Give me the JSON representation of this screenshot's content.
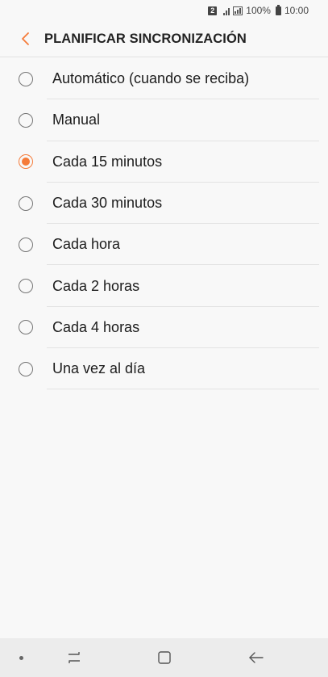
{
  "status_bar": {
    "sim_label": "2",
    "battery_text": "100%",
    "time": "10:00"
  },
  "header": {
    "title": "PLANIFICAR SINCRONIZACIÓN",
    "back_icon": "chevron-left-icon",
    "accent_color": "#f57b39"
  },
  "options": [
    {
      "label": "Automático (cuando se reciba)",
      "selected": false
    },
    {
      "label": "Manual",
      "selected": false
    },
    {
      "label": "Cada 15 minutos",
      "selected": true
    },
    {
      "label": "Cada 30 minutos",
      "selected": false
    },
    {
      "label": "Cada hora",
      "selected": false
    },
    {
      "label": "Cada 2 horas",
      "selected": false
    },
    {
      "label": "Cada 4 horas",
      "selected": false
    },
    {
      "label": "Una vez al día",
      "selected": false
    }
  ],
  "nav_bar": {
    "icons": [
      "dot-icon",
      "recent-apps-icon",
      "home-icon",
      "back-arrow-icon"
    ]
  }
}
